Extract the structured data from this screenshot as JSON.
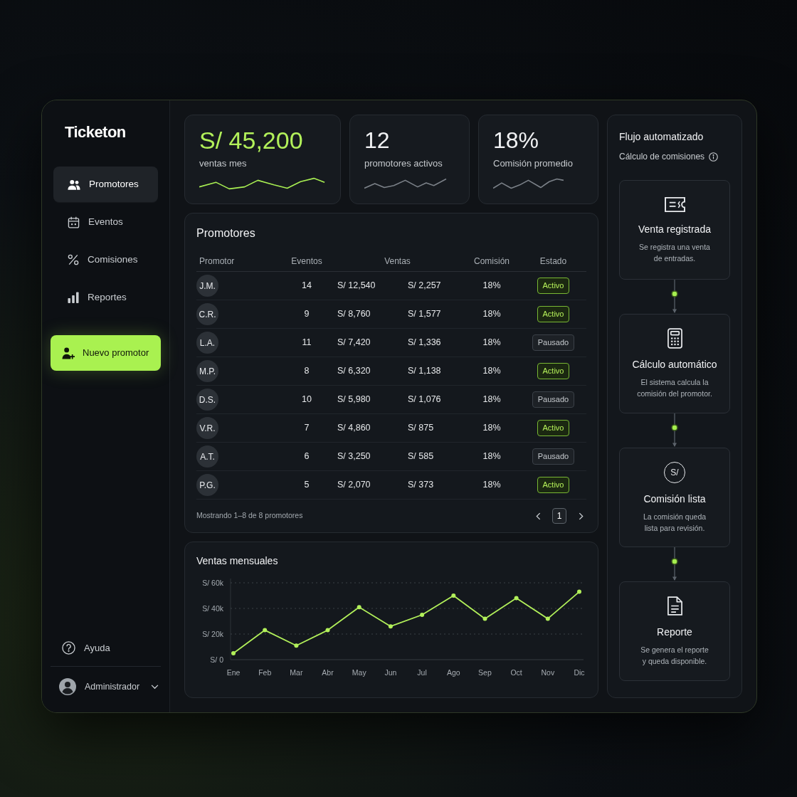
{
  "sidebar": {
    "app_name": "Ticketon",
    "items": [
      {
        "label": "Promotores",
        "kind": "users",
        "selected": true
      },
      {
        "label": "Eventos",
        "kind": "calendar",
        "selected": false
      },
      {
        "label": "Comisiones",
        "kind": "percent",
        "selected": false
      },
      {
        "label": "Reportes",
        "kind": "bars",
        "selected": false
      }
    ],
    "action_button": {
      "label": "Nuevo promotor"
    },
    "help": {
      "label": "Ayuda"
    },
    "user": {
      "name": "Administrador"
    }
  },
  "kpis": [
    {
      "value": "S/ 45,200",
      "label": "ventas mes",
      "highlighted": true
    },
    {
      "value": "12",
      "label": "promotores activos",
      "highlighted": false
    },
    {
      "value": "18%",
      "label": "Comisión promedio",
      "highlighted": false
    }
  ],
  "table": {
    "title": "Promotores",
    "columns": [
      "Promotor",
      "Eventos",
      "Ventas",
      "Comisión",
      "Estado"
    ],
    "rows": [
      {
        "initials": "J.M.",
        "eventos": "14",
        "ventas": "S/ 12,540",
        "column_4": "S/ 2,257",
        "comision": "18%",
        "estado": "Activo",
        "active": true
      },
      {
        "initials": "C.R.",
        "eventos": "9",
        "ventas": "S/ 8,760",
        "column_4": "S/ 1,577",
        "comision": "18%",
        "estado": "Activo",
        "active": true
      },
      {
        "initials": "L.A.",
        "eventos": "11",
        "ventas": "S/ 7,420",
        "column_4": "S/ 1,336",
        "comision": "18%",
        "estado": "Pausado",
        "active": false
      },
      {
        "initials": "M.P.",
        "eventos": "8",
        "ventas": "S/ 6,320",
        "column_4": "S/ 1,138",
        "comision": "18%",
        "estado": "Activo",
        "active": true
      },
      {
        "initials": "D.S.",
        "eventos": "10",
        "ventas": "S/ 5,980",
        "column_4": "S/ 1,076",
        "comision": "18%",
        "estado": "Pausado",
        "active": false
      },
      {
        "initials": "V.R.",
        "eventos": "7",
        "ventas": "S/ 4,860",
        "column_4": "S/ 875",
        "comision": "18%",
        "estado": "Activo",
        "active": true
      },
      {
        "initials": "A.T.",
        "eventos": "6",
        "ventas": "S/ 3,250",
        "column_4": "S/ 585",
        "comision": "18%",
        "estado": "Pausado",
        "active": false
      },
      {
        "initials": "P.G.",
        "eventos": "5",
        "ventas": "S/ 2,070",
        "column_4": "S/ 373",
        "comision": "18%",
        "estado": "Activo",
        "active": true
      }
    ],
    "footer": "Mostrando 1–8 de 8 promotores",
    "pagination": {
      "pages": [
        {
          "label": "1",
          "selected": true
        }
      ]
    }
  },
  "sales_chart": {
    "chart_data": {
      "type": "line",
      "title": "Ventas mensuales",
      "categories": [
        "Ene",
        "Feb",
        "Mar",
        "Abr",
        "May",
        "Jun",
        "Jul",
        "Ago",
        "Sep",
        "Oct",
        "Nov",
        "Dic"
      ],
      "series": [
        {
          "color": "#b2f05a",
          "marker": "circle",
          "values": [
            5000,
            23000,
            11000,
            23000,
            41000,
            26000,
            35000,
            50000,
            32000,
            48000,
            32000,
            53000
          ]
        }
      ],
      "ylim": [
        0,
        60000
      ],
      "yticks": [
        {
          "value": 0,
          "label": "S/ 0"
        },
        {
          "value": 20000,
          "label": "S/ 20k"
        },
        {
          "value": 40000,
          "label": "S/ 40k"
        },
        {
          "value": 60000,
          "label": "S/ 60k"
        }
      ]
    }
  },
  "flow": {
    "title": "Flujo automatizado",
    "subtitle": "Cálculo de comisiones",
    "steps": [
      {
        "kind": "ticket",
        "title": "Venta registrada",
        "description": "Se registra una venta\nde entradas."
      },
      {
        "kind": "calculator",
        "title": "Cálculo automático",
        "description": "El sistema calcula la\ncomisión del promotor."
      },
      {
        "kind": "currency",
        "symbol": "S/",
        "title": "Comisión lista",
        "description": "La comisión queda\nlista para revisión."
      },
      {
        "kind": "document",
        "title": "Reporte",
        "description": "Se genera el reporte\ny queda disponible."
      }
    ]
  }
}
